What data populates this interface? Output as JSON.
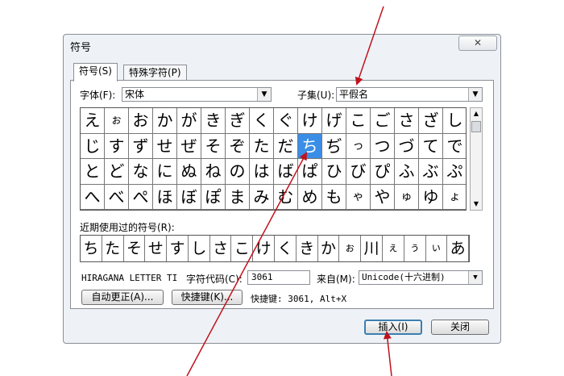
{
  "dialog": {
    "title": "符号",
    "close_button": "✕",
    "tabs": [
      "符号(S)",
      "特殊字符(P)"
    ],
    "font_label": "字体(F):",
    "font_value": "宋体",
    "subset_label": "子集(U):",
    "subset_value": "平假名",
    "symbols": [
      [
        "え",
        "ぉ",
        "お",
        "か",
        "が",
        "き",
        "ぎ",
        "く",
        "ぐ",
        "け",
        "げ",
        "こ",
        "ご",
        "さ",
        "ざ",
        "し"
      ],
      [
        "じ",
        "す",
        "ず",
        "せ",
        "ぜ",
        "そ",
        "ぞ",
        "た",
        "だ",
        "ち",
        "ぢ",
        "っ",
        "つ",
        "づ",
        "て",
        "で"
      ],
      [
        "と",
        "ど",
        "な",
        "に",
        "ぬ",
        "ね",
        "の",
        "は",
        "ば",
        "ぱ",
        "ひ",
        "び",
        "ぴ",
        "ふ",
        "ぶ",
        "ぷ"
      ],
      [
        "へ",
        "べ",
        "ぺ",
        "ほ",
        "ぼ",
        "ぽ",
        "ま",
        "み",
        "む",
        "め",
        "も",
        "ゃ",
        "や",
        "ゅ",
        "ゆ",
        "ょ"
      ]
    ],
    "selected_symbol": "ち",
    "recent_label": "近期使用过的符号(R):",
    "recent_symbols": [
      "ち",
      "た",
      "そ",
      "せ",
      "す",
      "し",
      "さ",
      "こ",
      "け",
      "く",
      "き",
      "か",
      "ぉ",
      "川",
      "ぇ",
      "ぅ",
      "ぃ",
      "あ"
    ],
    "char_name": "HIRAGANA LETTER TI",
    "char_code_label": "字符代码(C):",
    "char_code_value": "3061",
    "from_label": "来自(M):",
    "from_value": "Unicode(十六进制)",
    "autocorrect_button": "自动更正(A)...",
    "shortcut_button": "快捷键(K)...",
    "shortcut_text": "快捷键: 3061, Alt+X",
    "insert_button": "插入(I)",
    "cancel_button": "关闭"
  },
  "colors": {
    "selection": "#3a8ee6",
    "arrow": "#c0121c"
  }
}
